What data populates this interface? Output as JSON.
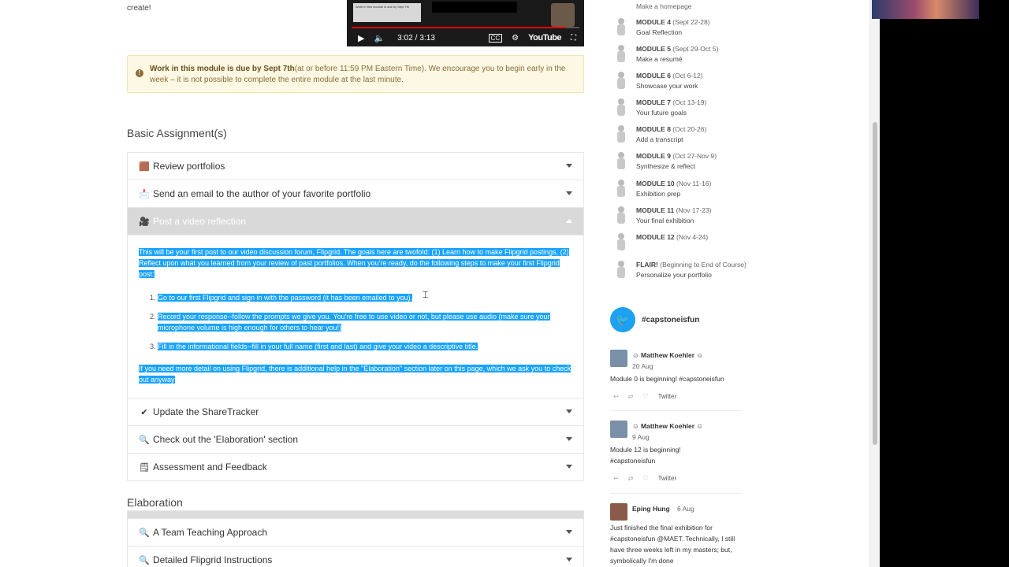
{
  "intro": {
    "text": "create!"
  },
  "video": {
    "thumb_text": "Work in this module is due by Sept 7th",
    "current_time": "3:02",
    "duration": "3:13",
    "separator": "/",
    "progress_fraction": 0.94,
    "brand": "YouTube",
    "icons": [
      "play-icon",
      "volume-icon",
      "captions-icon",
      "gear-icon",
      "fullscreen-icon"
    ]
  },
  "notice": {
    "bold": "Work in this module is due by Sept 7th",
    "text": "(at or before 11:59 PM Eastern Time). We encourage you to begin early in the week – it is not possible to complete the entire module at the last minute."
  },
  "sections": {
    "basic_title": "Basic Assignment(s)",
    "elaboration_title": "Elaboration"
  },
  "basic_items": [
    {
      "emoji": "🟫",
      "label": "Review portfolios"
    },
    {
      "emoji": "📩",
      "label": "Send an email to the author of your favorite portfolio"
    },
    {
      "emoji": "🎥",
      "label": "Post a video reflection"
    },
    {
      "emoji": "✔",
      "label": "Update the ShareTracker"
    },
    {
      "emoji": "🔍",
      "label": "Check out the 'Elaboration' section"
    },
    {
      "emoji": "🗒",
      "label": "Assessment and Feedback"
    }
  ],
  "expanded": {
    "intro": "This will be your first post to our video discussion forum, Flipgrid. The goals here are twofold: (1) Learn how to make Flipgrid postings, (2) Reflect upon what you learned from your review of past portfolios. When you're ready, do the following steps to make your first Flipgrid post:",
    "steps": [
      "Go to our first Flipgrid and sign in with the password (it has been emailed to you).",
      "Record your response--follow the prompts we give you. You're free to use video or not, but please use audio (make sure your microphone volume is high enough for others to hear you!)",
      "Fill in the informational fields--fill in your full name (first and last) and give your video a descriptive title."
    ],
    "outro": "If you need more detail on using Flipgrid, there is additional help in the \"Elaboration\" section later on this page, which we ask you to check out anyway"
  },
  "elaboration_items": [
    {
      "emoji": "🔍",
      "label": "A Team Teaching Approach"
    },
    {
      "emoji": "🔍",
      "label": "Detailed Flipgrid Instructions"
    }
  ],
  "modules": [
    {
      "name": "",
      "date": "",
      "desc": "Make a homepage"
    },
    {
      "name": "MODULE 4",
      "date": "(Sept 22-28)",
      "desc": "Goal Reflection"
    },
    {
      "name": "MODULE 5",
      "date": "(Sept 29-Oct 5)",
      "desc": "Make a resumé"
    },
    {
      "name": "MODULE 6",
      "date": "(Oct 6-12)",
      "desc": "Showcase your work"
    },
    {
      "name": "MODULE 7",
      "date": "(Oct 13-19)",
      "desc": "Your future goals"
    },
    {
      "name": "MODULE 8",
      "date": "(Oct 20-26)",
      "desc": "Add a transcript"
    },
    {
      "name": "MODULE 9",
      "date": "(Oct 27-Nov 9)",
      "desc": "Synthesize & reflect"
    },
    {
      "name": "MODULE 10",
      "date": "(Nov 11-16)",
      "desc": "Exhibition prep"
    },
    {
      "name": "MODULE 11",
      "date": "(Nov 17-23)",
      "desc": "Your final exhibition"
    },
    {
      "name": "MODULE 12",
      "date": "(Nov 4-24)",
      "desc": ""
    },
    {
      "name": "FLAIR!",
      "date": "(Beginning to End of Course)",
      "desc": "Personalize your portfolio"
    }
  ],
  "twitter": {
    "hashtag": "#capstoneisfun",
    "tweets": [
      {
        "author": "☺ Matthew Koehler ☺",
        "date": "20 Aug",
        "text": "Module 0 is beginning! #capstoneisfun",
        "source": "Twitter"
      },
      {
        "author": "☺ Matthew Koehler ☺",
        "date": "9 Aug",
        "text": "Module 12 is beginning! #capstoneisfun",
        "source": "Twitter"
      },
      {
        "author": "Eping Hung",
        "date": "6 Aug",
        "text": "Just finished the final exhibition for #capstoneisfun @MAET. Technically, I still have three weeks left in my masters; but, symbolically I'm done",
        "source": ""
      }
    ]
  },
  "colors": {
    "highlight": "#1aa3ff",
    "twitter": "#1da1f2",
    "notice_bg": "#fcf8e3",
    "open_header": "#d9d9d9"
  }
}
